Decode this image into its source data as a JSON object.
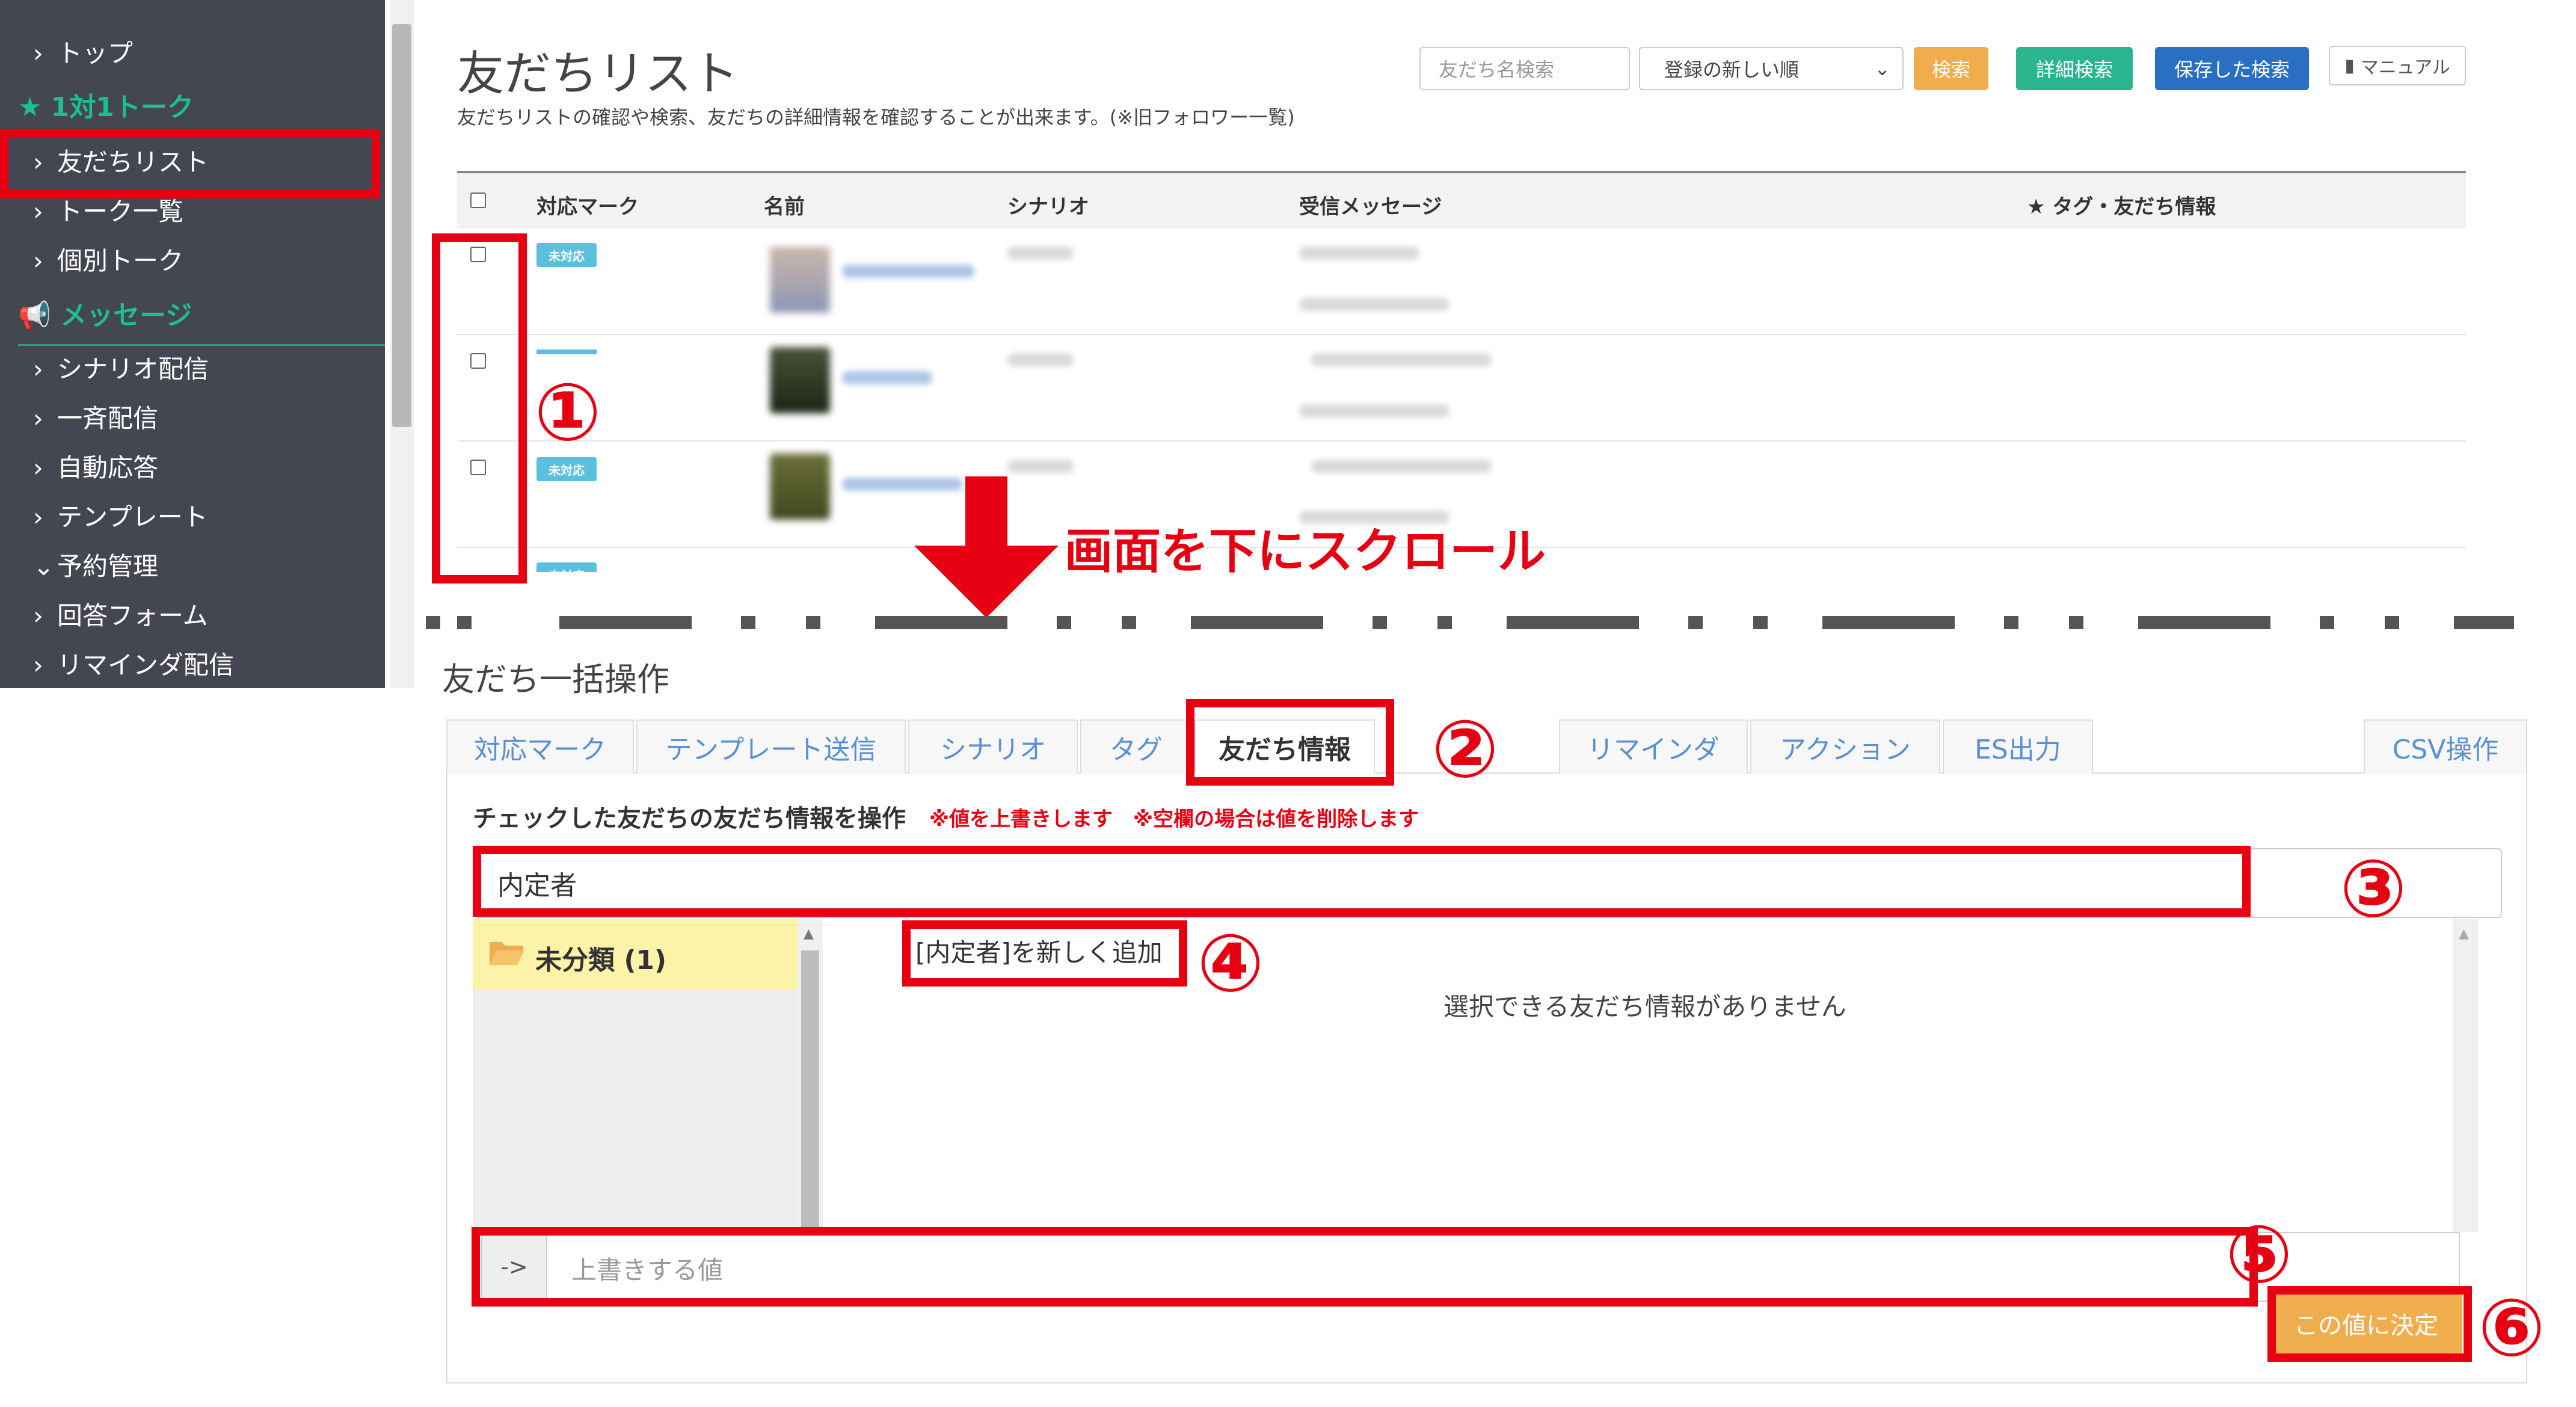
{
  "sidebar": {
    "items": [
      {
        "label": "トップ"
      },
      {
        "label": "1対1トーク",
        "kind": "header"
      },
      {
        "label": "友だちリスト"
      },
      {
        "label": "トーク一覧"
      },
      {
        "label": "個別トーク"
      },
      {
        "label": "メッセージ",
        "kind": "header"
      },
      {
        "label": "シナリオ配信"
      },
      {
        "label": "一斉配信"
      },
      {
        "label": "自動応答"
      },
      {
        "label": "テンプレート"
      },
      {
        "label": "予約管理",
        "expanded": true
      },
      {
        "label": "回答フォーム"
      },
      {
        "label": "リマインダ配信"
      }
    ]
  },
  "header": {
    "title": "友だちリスト",
    "description": "友だちリストの確認や検索、友だちの詳細情報を確認することが出来ます。(※旧フォロワー一覧)",
    "search_placeholder": "友だち名検索",
    "sort_value": "登録の新しい順",
    "search_button": "検索",
    "advanced_button": "詳細検索",
    "saved_button": "保存した検索",
    "manual_button": "マニュアル"
  },
  "table": {
    "columns": [
      "対応マーク",
      "名前",
      "シナリオ",
      "受信メッセージ",
      "★ タグ・友だち情報"
    ],
    "rows": [
      {
        "badge": "未対応"
      },
      {
        "badge": ""
      },
      {
        "badge": "未対応"
      },
      {
        "badge": "未対応"
      }
    ]
  },
  "annotations": {
    "n1": "①",
    "n2": "②",
    "n3": "③",
    "n4": "④",
    "n5": "⑤",
    "n6": "⑥",
    "scroll_note": "画面を下にスクロール",
    "accent_color": "#e60012"
  },
  "bulk": {
    "title": "友だち一括操作",
    "tabs": [
      "対応マーク",
      "テンプレート送信",
      "シナリオ",
      "タグ",
      "友だち情報",
      "リマインダ",
      "アクション",
      "ES出力",
      "CSV操作"
    ],
    "active_tab": "友だち情報",
    "operation_label": "チェックした友だちの友だち情報を操作",
    "operation_note": "※値を上書きします　※空欄の場合は値を削除します",
    "input_value": "内定者",
    "category": "未分類 (1)",
    "add_option": "[内定者]を新しく追加",
    "empty_message": "選択できる友だち情報がありません",
    "arrow_label": "->",
    "value_placeholder": "上書きする値",
    "confirm_button": "この値に決定"
  },
  "colors": {
    "sidebar_bg": "#444651",
    "sidebar_accent": "#1dbf8f",
    "badge": "#5bc0de",
    "button_orange": "#f0ad4e",
    "button_green": "#2bb58f",
    "button_blue": "#2a6fc1"
  }
}
